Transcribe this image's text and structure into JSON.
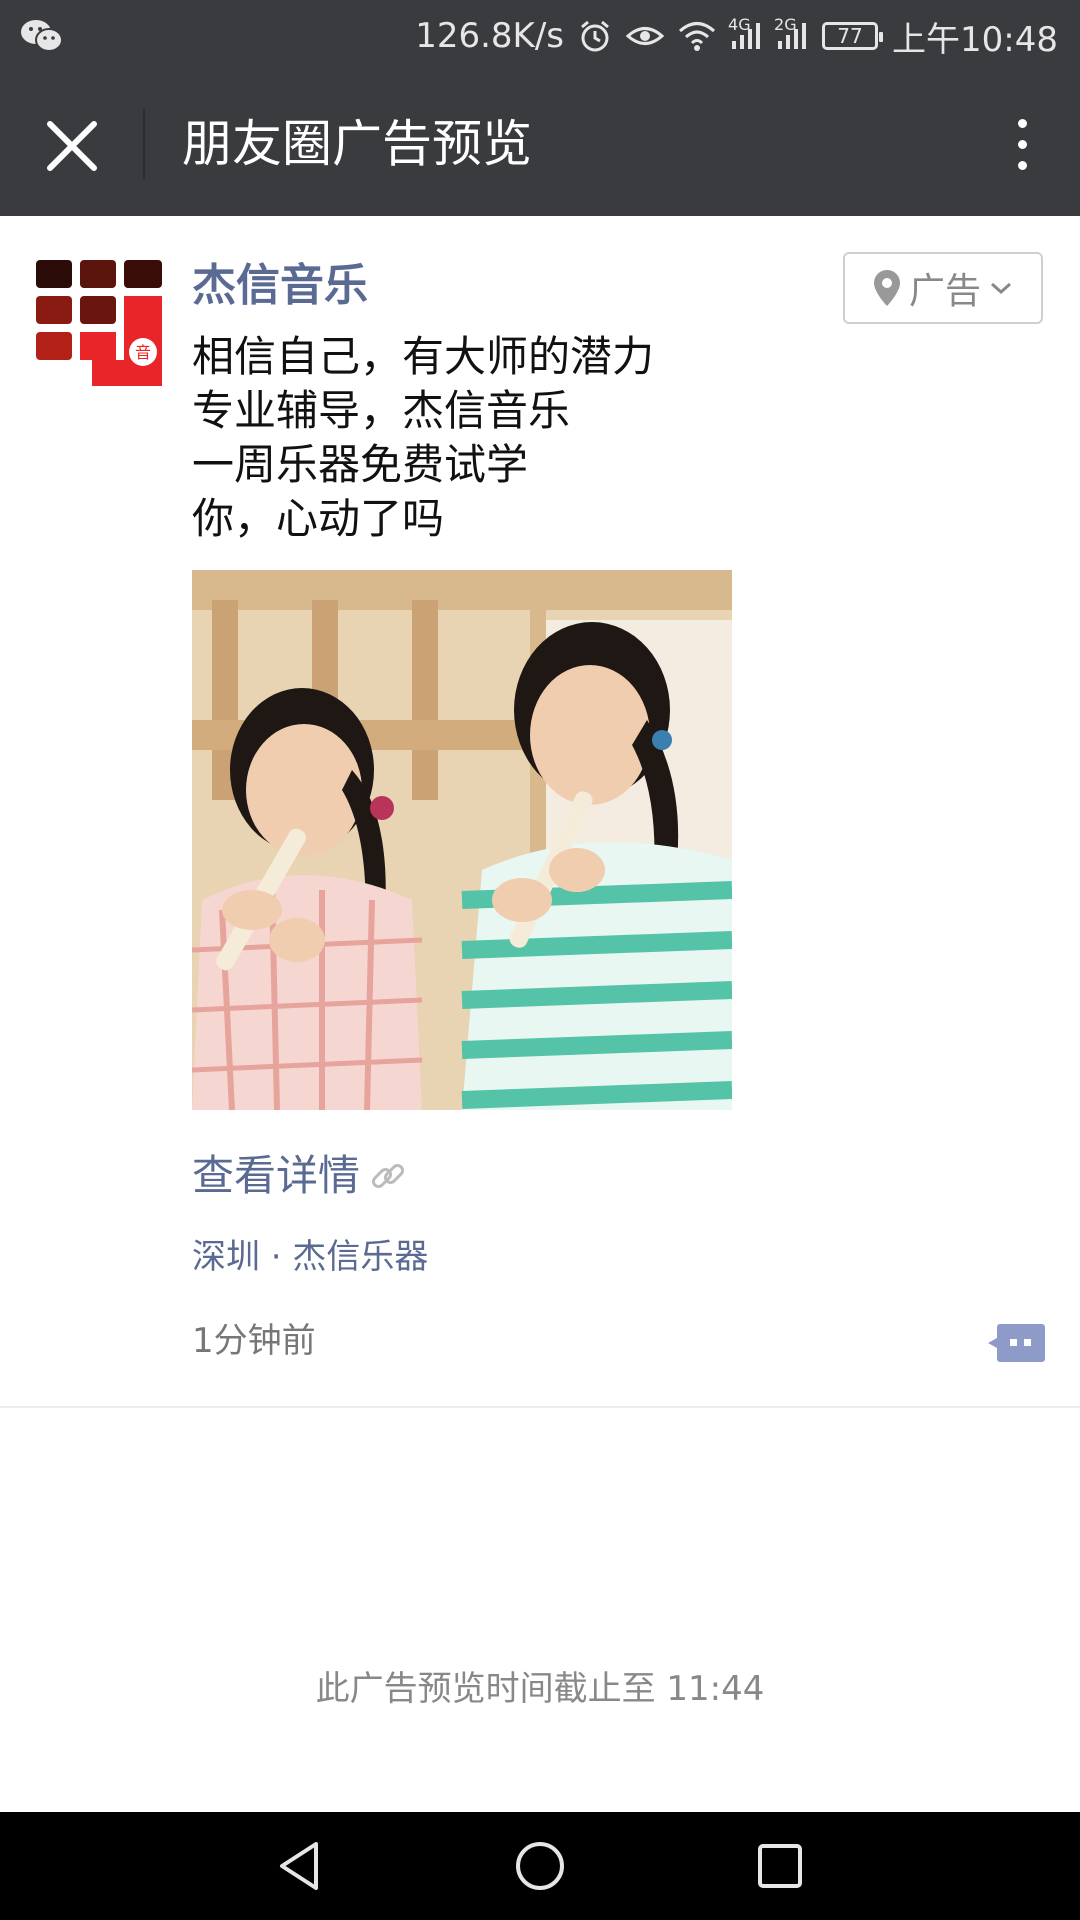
{
  "status_bar": {
    "network_speed": "126.8K/s",
    "net1": "4G",
    "net2": "2G",
    "battery": "77",
    "time": "上午10:48"
  },
  "title_bar": {
    "title": "朋友圈广告预览"
  },
  "post": {
    "author": "杰信音乐",
    "ad_label": "广告",
    "text_lines": [
      "相信自己，有大师的潜力",
      "专业辅导，杰信音乐",
      "一周乐器免费试学",
      "你，心动了吗"
    ],
    "detail_link": "查看详情",
    "location": "深圳 · 杰信乐器",
    "timestamp": "1分钟前"
  },
  "expiry_notice": "此广告预览时间截止至 11:44",
  "colors": {
    "bar_bg": "#3a3b3f",
    "link": "#5b6a92",
    "avatar_red": "#e8262a"
  },
  "icons": {
    "close": "close-icon",
    "more": "more-vert-icon",
    "location_pin": "location-pin-icon",
    "chevron": "chevron-down-icon",
    "link": "link-icon",
    "comment": "comment-icon"
  }
}
